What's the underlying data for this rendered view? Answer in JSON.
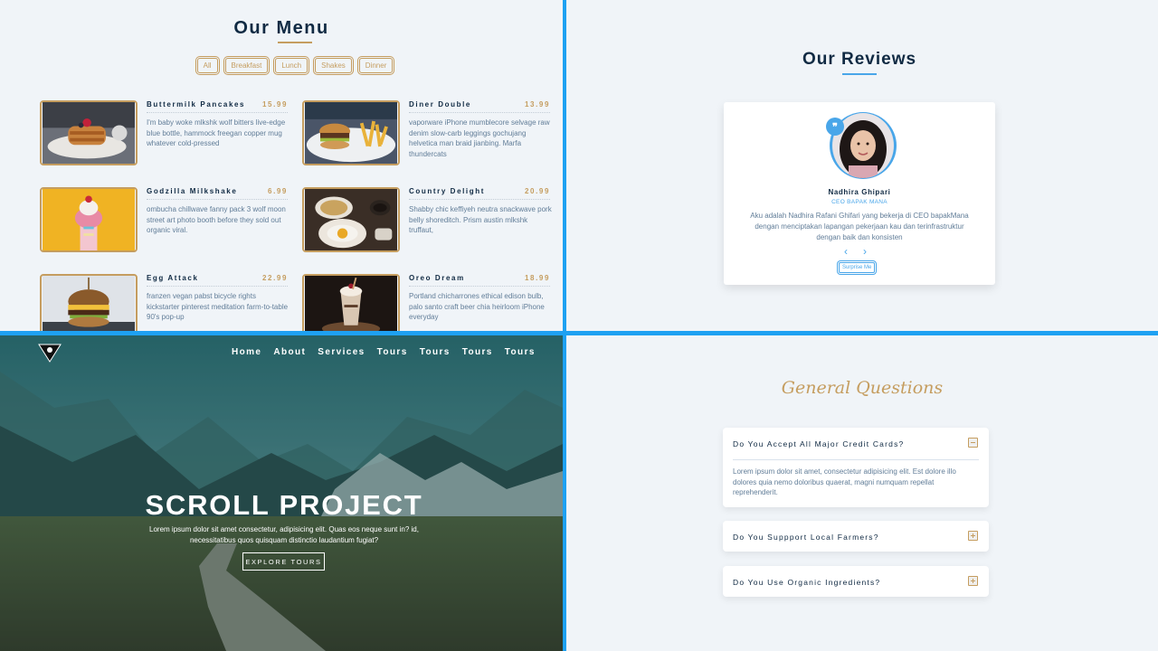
{
  "menu": {
    "title": "Our Menu",
    "filters": [
      "All",
      "Breakfast",
      "Lunch",
      "Shakes",
      "Dinner"
    ],
    "items": [
      {
        "name": "Buttermilk Pancakes",
        "price": "15.99",
        "desc": "I'm baby woke mlkshk wolf bitters live-edge blue bottle, hammock freegan copper mug whatever cold-pressed"
      },
      {
        "name": "Diner Double",
        "price": "13.99",
        "desc": "vaporware iPhone mumblecore selvage raw denim slow-carb leggings gochujang helvetica man braid jianbing. Marfa thundercats"
      },
      {
        "name": "Godzilla Milkshake",
        "price": "6.99",
        "desc": "ombucha chillwave fanny pack 3 wolf moon street art photo booth before they sold out organic viral."
      },
      {
        "name": "Country Delight",
        "price": "20.99",
        "desc": "Shabby chic keffiyeh neutra snackwave pork belly shoreditch. Prism austin mlkshk truffaut,"
      },
      {
        "name": "Egg Attack",
        "price": "22.99",
        "desc": "franzen vegan pabst bicycle rights kickstarter pinterest meditation farm-to-table 90's pop-up"
      },
      {
        "name": "Oreo Dream",
        "price": "18.99",
        "desc": "Portland chicharrones ethical edison bulb, palo santo craft beer chia heirloom iPhone everyday"
      }
    ]
  },
  "reviews": {
    "title": "Our Reviews",
    "name": "Nadhira Ghipari",
    "job": "CEO BAPAK MANA",
    "text": "Aku adalah Nadhira Rafani Ghifari yang bekerja di CEO bapakMana dengan menciptakan lapangan pekerjaan kau dan terinfrastruktur dengan baik dan konsisten",
    "quote_icon": "❞",
    "prev_icon": "‹",
    "next_icon": "›",
    "random_label": "Surprise Me"
  },
  "hero": {
    "nav": [
      "Home",
      "About",
      "Services",
      "Tours",
      "Tours",
      "Tours",
      "Tours"
    ],
    "title": "SCROLL PROJECT",
    "text": "Lorem ipsum dolor sit amet consectetur, adipisicing elit. Quas eos neque sunt in? id, necessitatibus quos quisquam distinctio laudantium fugiat?",
    "button": "EXPLORE TOURS"
  },
  "faq": {
    "title": "General Questions",
    "questions": [
      {
        "q": "Do You Accept All Major Credit Cards?",
        "a": "Lorem ipsum dolor sit amet, consectetur adipisicing elit. Est dolore illo dolores quia nemo doloribus quaerat, magni numquam repellat reprehenderit.",
        "state": "open"
      },
      {
        "q": "Do You Suppport Local Farmers?",
        "state": "closed"
      },
      {
        "q": "Do You Use Organic Ingredients?",
        "state": "closed"
      }
    ]
  },
  "colors": {
    "gold": "#c59d5f",
    "blue": "#49a6e9",
    "dark": "#102a43",
    "grey": "#617d98",
    "divider": "#1ea1f2"
  }
}
